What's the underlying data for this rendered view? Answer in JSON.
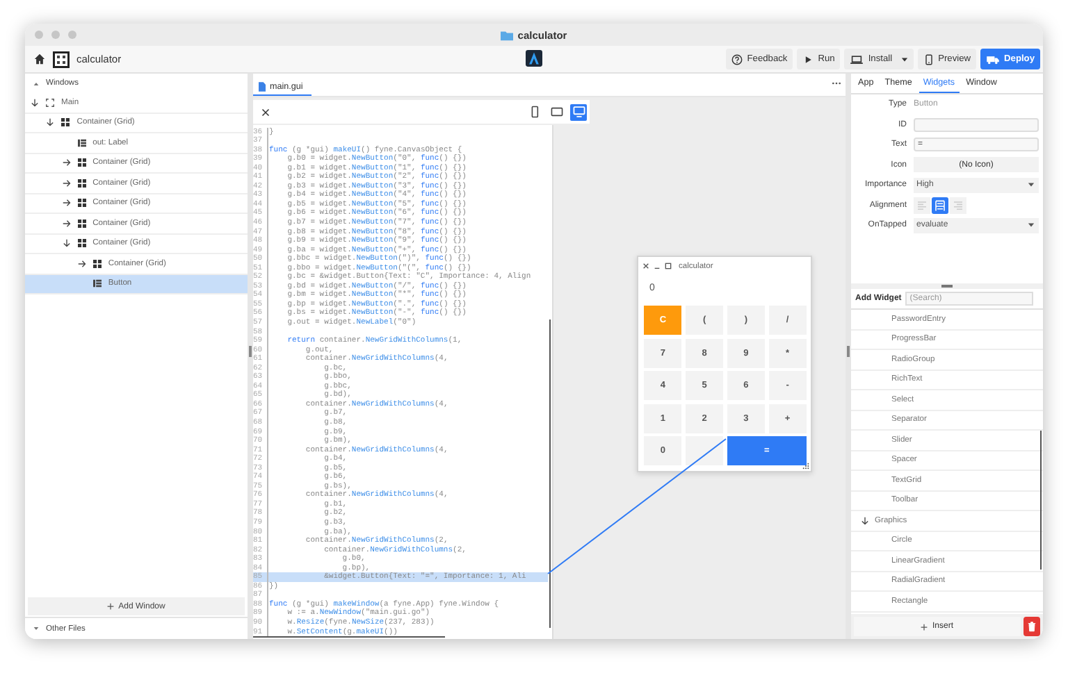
{
  "window": {
    "title": "calculator"
  },
  "toolbar": {
    "project": "calculator",
    "buttons": [
      {
        "label": "Feedback",
        "kind": "help",
        "primary": false,
        "dropdown": false
      },
      {
        "label": "Run",
        "kind": "run",
        "primary": false,
        "dropdown": false
      },
      {
        "label": "Install",
        "kind": "install",
        "primary": false,
        "dropdown": true
      },
      {
        "label": "Preview",
        "kind": "preview",
        "primary": false,
        "dropdown": false
      },
      {
        "label": "Deploy",
        "kind": "deploy",
        "primary": true,
        "dropdown": false
      }
    ]
  },
  "sidebar": {
    "header": "Windows",
    "tree": [
      {
        "label": "Main",
        "kind": "window",
        "expanded": true,
        "selected": false,
        "children": [
          {
            "label": "Container (Grid)",
            "kind": "container",
            "expanded": true,
            "selected": false,
            "children": [
              {
                "label": "out: Label",
                "kind": "widget",
                "selected": false
              },
              {
                "label": "Container (Grid)",
                "kind": "container",
                "expanded": false,
                "selected": false
              },
              {
                "label": "Container (Grid)",
                "kind": "container",
                "expanded": false,
                "selected": false
              },
              {
                "label": "Container (Grid)",
                "kind": "container",
                "expanded": false,
                "selected": false
              },
              {
                "label": "Container (Grid)",
                "kind": "container",
                "expanded": false,
                "selected": false
              },
              {
                "label": "Container (Grid)",
                "kind": "container",
                "expanded": true,
                "selected": false,
                "children": [
                  {
                    "label": "Container (Grid)",
                    "kind": "container",
                    "expanded": false,
                    "selected": false
                  },
                  {
                    "label": "Button",
                    "kind": "widget",
                    "selected": true
                  }
                ]
              }
            ]
          }
        ]
      }
    ],
    "add_button": "Add Window",
    "footer": "Other Files"
  },
  "editor": {
    "tabs": [
      {
        "label": "main.gui",
        "selected": true
      }
    ],
    "devices": [
      {
        "kind": "phone",
        "selected": false
      },
      {
        "kind": "tablet",
        "selected": false
      },
      {
        "kind": "desktop",
        "selected": true
      }
    ],
    "lines": [
      {
        "number": "36",
        "selected": false,
        "tokens": [
          {
            "kind": "plain",
            "text": "}"
          }
        ]
      },
      {
        "number": "37",
        "selected": false
      },
      {
        "number": "38",
        "selected": false,
        "tokens": [
          {
            "kind": "keyword",
            "text": "func"
          },
          {
            "kind": "plain",
            "text": " (g *gui) "
          },
          {
            "kind": "call",
            "text": "makeUI"
          },
          {
            "kind": "plain",
            "text": "() fyne.CanvasObject {"
          }
        ]
      },
      {
        "number": "39",
        "selected": false,
        "tokens": [
          {
            "kind": "plain",
            "text": "    g.b0 = widget."
          },
          {
            "kind": "call",
            "text": "NewButton"
          },
          {
            "kind": "plain",
            "text": "(\"0\", "
          },
          {
            "kind": "keyword",
            "text": "func"
          },
          {
            "kind": "plain",
            "text": "() {})"
          }
        ]
      },
      {
        "number": "40",
        "selected": false,
        "tokens": [
          {
            "kind": "plain",
            "text": "    g.b1 = widget."
          },
          {
            "kind": "call",
            "text": "NewButton"
          },
          {
            "kind": "plain",
            "text": "(\"1\", "
          },
          {
            "kind": "keyword",
            "text": "func"
          },
          {
            "kind": "plain",
            "text": "() {})"
          }
        ]
      },
      {
        "number": "41",
        "selected": false,
        "tokens": [
          {
            "kind": "plain",
            "text": "    g.b2 = widget."
          },
          {
            "kind": "call",
            "text": "NewButton"
          },
          {
            "kind": "plain",
            "text": "(\"2\", "
          },
          {
            "kind": "keyword",
            "text": "func"
          },
          {
            "kind": "plain",
            "text": "() {})"
          }
        ]
      },
      {
        "number": "42",
        "selected": false,
        "tokens": [
          {
            "kind": "plain",
            "text": "    g.b3 = widget."
          },
          {
            "kind": "call",
            "text": "NewButton"
          },
          {
            "kind": "plain",
            "text": "(\"3\", "
          },
          {
            "kind": "keyword",
            "text": "func"
          },
          {
            "kind": "plain",
            "text": "() {})"
          }
        ]
      },
      {
        "number": "43",
        "selected": false,
        "tokens": [
          {
            "kind": "plain",
            "text": "    g.b4 = widget."
          },
          {
            "kind": "call",
            "text": "NewButton"
          },
          {
            "kind": "plain",
            "text": "(\"4\", "
          },
          {
            "kind": "keyword",
            "text": "func"
          },
          {
            "kind": "plain",
            "text": "() {})"
          }
        ]
      },
      {
        "number": "44",
        "selected": false,
        "tokens": [
          {
            "kind": "plain",
            "text": "    g.b5 = widget."
          },
          {
            "kind": "call",
            "text": "NewButton"
          },
          {
            "kind": "plain",
            "text": "(\"5\", "
          },
          {
            "kind": "keyword",
            "text": "func"
          },
          {
            "kind": "plain",
            "text": "() {})"
          }
        ]
      },
      {
        "number": "45",
        "selected": false,
        "tokens": [
          {
            "kind": "plain",
            "text": "    g.b6 = widget."
          },
          {
            "kind": "call",
            "text": "NewButton"
          },
          {
            "kind": "plain",
            "text": "(\"6\", "
          },
          {
            "kind": "keyword",
            "text": "func"
          },
          {
            "kind": "plain",
            "text": "() {})"
          }
        ]
      },
      {
        "number": "46",
        "selected": false,
        "tokens": [
          {
            "kind": "plain",
            "text": "    g.b7 = widget."
          },
          {
            "kind": "call",
            "text": "NewButton"
          },
          {
            "kind": "plain",
            "text": "(\"7\", "
          },
          {
            "kind": "keyword",
            "text": "func"
          },
          {
            "kind": "plain",
            "text": "() {})"
          }
        ]
      },
      {
        "number": "47",
        "selected": false,
        "tokens": [
          {
            "kind": "plain",
            "text": "    g.b8 = widget."
          },
          {
            "kind": "call",
            "text": "NewButton"
          },
          {
            "kind": "plain",
            "text": "(\"8\", "
          },
          {
            "kind": "keyword",
            "text": "func"
          },
          {
            "kind": "plain",
            "text": "() {})"
          }
        ]
      },
      {
        "number": "48",
        "selected": false,
        "tokens": [
          {
            "kind": "plain",
            "text": "    g.b9 = widget."
          },
          {
            "kind": "call",
            "text": "NewButton"
          },
          {
            "kind": "plain",
            "text": "(\"9\", "
          },
          {
            "kind": "keyword",
            "text": "func"
          },
          {
            "kind": "plain",
            "text": "() {})"
          }
        ]
      },
      {
        "number": "49",
        "selected": false,
        "tokens": [
          {
            "kind": "plain",
            "text": "    g.ba = widget."
          },
          {
            "kind": "call",
            "text": "NewButton"
          },
          {
            "kind": "plain",
            "text": "(\"+\", "
          },
          {
            "kind": "keyword",
            "text": "func"
          },
          {
            "kind": "plain",
            "text": "() {})"
          }
        ]
      },
      {
        "number": "50",
        "selected": false,
        "tokens": [
          {
            "kind": "plain",
            "text": "    g.bbc = widget."
          },
          {
            "kind": "call",
            "text": "NewButton"
          },
          {
            "kind": "plain",
            "text": "(\")\", "
          },
          {
            "kind": "keyword",
            "text": "func"
          },
          {
            "kind": "plain",
            "text": "() {})"
          }
        ]
      },
      {
        "number": "51",
        "selected": false,
        "tokens": [
          {
            "kind": "plain",
            "text": "    g.bbo = widget."
          },
          {
            "kind": "call",
            "text": "NewButton"
          },
          {
            "kind": "plain",
            "text": "(\"(\", "
          },
          {
            "kind": "keyword",
            "text": "func"
          },
          {
            "kind": "plain",
            "text": "() {})"
          }
        ]
      },
      {
        "number": "52",
        "selected": false,
        "tokens": [
          {
            "kind": "plain",
            "text": "    g.bc = &widget.Button{Text: \"C\", Importance: 4, Align"
          }
        ]
      },
      {
        "number": "53",
        "selected": false,
        "tokens": [
          {
            "kind": "plain",
            "text": "    g.bd = widget."
          },
          {
            "kind": "call",
            "text": "NewButton"
          },
          {
            "kind": "plain",
            "text": "(\"/\", "
          },
          {
            "kind": "keyword",
            "text": "func"
          },
          {
            "kind": "plain",
            "text": "() {})"
          }
        ]
      },
      {
        "number": "54",
        "selected": false,
        "tokens": [
          {
            "kind": "plain",
            "text": "    g.bm = widget."
          },
          {
            "kind": "call",
            "text": "NewButton"
          },
          {
            "kind": "plain",
            "text": "(\"*\", "
          },
          {
            "kind": "keyword",
            "text": "func"
          },
          {
            "kind": "plain",
            "text": "() {})"
          }
        ]
      },
      {
        "number": "55",
        "selected": false,
        "tokens": [
          {
            "kind": "plain",
            "text": "    g.bp = widget."
          },
          {
            "kind": "call",
            "text": "NewButton"
          },
          {
            "kind": "plain",
            "text": "(\".\", "
          },
          {
            "kind": "keyword",
            "text": "func"
          },
          {
            "kind": "plain",
            "text": "() {})"
          }
        ]
      },
      {
        "number": "56",
        "selected": false,
        "tokens": [
          {
            "kind": "plain",
            "text": "    g.bs = widget."
          },
          {
            "kind": "call",
            "text": "NewButton"
          },
          {
            "kind": "plain",
            "text": "(\"-\", "
          },
          {
            "kind": "keyword",
            "text": "func"
          },
          {
            "kind": "plain",
            "text": "() {})"
          }
        ]
      },
      {
        "number": "57",
        "selected": false,
        "tokens": [
          {
            "kind": "plain",
            "text": "    g.out = widget."
          },
          {
            "kind": "call",
            "text": "NewLabel"
          },
          {
            "kind": "plain",
            "text": "(\"0\")"
          }
        ]
      },
      {
        "number": "58",
        "selected": false
      },
      {
        "number": "59",
        "selected": false,
        "tokens": [
          {
            "kind": "keyword",
            "text": "    return"
          },
          {
            "kind": "plain",
            "text": " container."
          },
          {
            "kind": "call",
            "text": "NewGridWithColumns"
          },
          {
            "kind": "plain",
            "text": "(1,"
          }
        ]
      },
      {
        "number": "60",
        "selected": false,
        "tokens": [
          {
            "kind": "plain",
            "text": "        g.out,"
          }
        ]
      },
      {
        "number": "61",
        "selected": false,
        "tokens": [
          {
            "kind": "plain",
            "text": "        container."
          },
          {
            "kind": "call",
            "text": "NewGridWithColumns"
          },
          {
            "kind": "plain",
            "text": "(4,"
          }
        ]
      },
      {
        "number": "62",
        "selected": false,
        "tokens": [
          {
            "kind": "plain",
            "text": "            g.bc,"
          }
        ]
      },
      {
        "number": "63",
        "selected": false,
        "tokens": [
          {
            "kind": "plain",
            "text": "            g.bbo,"
          }
        ]
      },
      {
        "number": "64",
        "selected": false,
        "tokens": [
          {
            "kind": "plain",
            "text": "            g.bbc,"
          }
        ]
      },
      {
        "number": "65",
        "selected": false,
        "tokens": [
          {
            "kind": "plain",
            "text": "            g.bd),"
          }
        ]
      },
      {
        "number": "66",
        "selected": false,
        "tokens": [
          {
            "kind": "plain",
            "text": "        container."
          },
          {
            "kind": "call",
            "text": "NewGridWithColumns"
          },
          {
            "kind": "plain",
            "text": "(4,"
          }
        ]
      },
      {
        "number": "67",
        "selected": false,
        "tokens": [
          {
            "kind": "plain",
            "text": "            g.b7,"
          }
        ]
      },
      {
        "number": "68",
        "selected": false,
        "tokens": [
          {
            "kind": "plain",
            "text": "            g.b8,"
          }
        ]
      },
      {
        "number": "69",
        "selected": false,
        "tokens": [
          {
            "kind": "plain",
            "text": "            g.b9,"
          }
        ]
      },
      {
        "number": "70",
        "selected": false,
        "tokens": [
          {
            "kind": "plain",
            "text": "            g.bm),"
          }
        ]
      },
      {
        "number": "71",
        "selected": false,
        "tokens": [
          {
            "kind": "plain",
            "text": "        container."
          },
          {
            "kind": "call",
            "text": "NewGridWithColumns"
          },
          {
            "kind": "plain",
            "text": "(4,"
          }
        ]
      },
      {
        "number": "72",
        "selected": false,
        "tokens": [
          {
            "kind": "plain",
            "text": "            g.b4,"
          }
        ]
      },
      {
        "number": "73",
        "selected": false,
        "tokens": [
          {
            "kind": "plain",
            "text": "            g.b5,"
          }
        ]
      },
      {
        "number": "74",
        "selected": false,
        "tokens": [
          {
            "kind": "plain",
            "text": "            g.b6,"
          }
        ]
      },
      {
        "number": "75",
        "selected": false,
        "tokens": [
          {
            "kind": "plain",
            "text": "            g.bs),"
          }
        ]
      },
      {
        "number": "76",
        "selected": false,
        "tokens": [
          {
            "kind": "plain",
            "text": "        container."
          },
          {
            "kind": "call",
            "text": "NewGridWithColumns"
          },
          {
            "kind": "plain",
            "text": "(4,"
          }
        ]
      },
      {
        "number": "77",
        "selected": false,
        "tokens": [
          {
            "kind": "plain",
            "text": "            g.b1,"
          }
        ]
      },
      {
        "number": "78",
        "selected": false,
        "tokens": [
          {
            "kind": "plain",
            "text": "            g.b2,"
          }
        ]
      },
      {
        "number": "79",
        "selected": false,
        "tokens": [
          {
            "kind": "plain",
            "text": "            g.b3,"
          }
        ]
      },
      {
        "number": "80",
        "selected": false,
        "tokens": [
          {
            "kind": "plain",
            "text": "            g.ba),"
          }
        ]
      },
      {
        "number": "81",
        "selected": false,
        "tokens": [
          {
            "kind": "plain",
            "text": "        container."
          },
          {
            "kind": "call",
            "text": "NewGridWithColumns"
          },
          {
            "kind": "plain",
            "text": "(2,"
          }
        ]
      },
      {
        "number": "82",
        "selected": false,
        "tokens": [
          {
            "kind": "plain",
            "text": "            container."
          },
          {
            "kind": "call",
            "text": "NewGridWithColumns"
          },
          {
            "kind": "plain",
            "text": "(2,"
          }
        ]
      },
      {
        "number": "83",
        "selected": false,
        "tokens": [
          {
            "kind": "plain",
            "text": "                g.b0,"
          }
        ]
      },
      {
        "number": "84",
        "selected": false,
        "tokens": [
          {
            "kind": "plain",
            "text": "                g.bp),"
          }
        ]
      },
      {
        "number": "85",
        "selected": true,
        "tokens": [
          {
            "kind": "plain",
            "text": "            &widget.Button{Text: \"=\", Importance: 1, Ali"
          }
        ]
      },
      {
        "number": "86",
        "selected": false,
        "tokens": [
          {
            "kind": "plain",
            "text": "})"
          }
        ]
      },
      {
        "number": "87",
        "selected": false
      },
      {
        "number": "88",
        "selected": false,
        "tokens": [
          {
            "kind": "keyword",
            "text": "func"
          },
          {
            "kind": "plain",
            "text": " (g *gui) "
          },
          {
            "kind": "call",
            "text": "makeWindow"
          },
          {
            "kind": "plain",
            "text": "(a fyne.App) fyne.Window {"
          }
        ]
      },
      {
        "number": "89",
        "selected": false,
        "tokens": [
          {
            "kind": "plain",
            "text": "    w := a."
          },
          {
            "kind": "call",
            "text": "NewWindow"
          },
          {
            "kind": "plain",
            "text": "(\"main.gui.go\")"
          }
        ]
      },
      {
        "number": "90",
        "selected": false,
        "tokens": [
          {
            "kind": "plain",
            "text": "    w."
          },
          {
            "kind": "call",
            "text": "Resize"
          },
          {
            "kind": "plain",
            "text": "(fyne."
          },
          {
            "kind": "call",
            "text": "NewSize"
          },
          {
            "kind": "plain",
            "text": "(237, 283))"
          }
        ]
      },
      {
        "number": "91",
        "selected": false,
        "tokens": [
          {
            "kind": "plain",
            "text": "    w."
          },
          {
            "kind": "call",
            "text": "SetContent"
          },
          {
            "kind": "plain",
            "text": "(g."
          },
          {
            "kind": "call",
            "text": "makeUI"
          },
          {
            "kind": "plain",
            "text": "())"
          }
        ]
      }
    ]
  },
  "preview": {
    "title": "calculator",
    "display": "0",
    "keys": [
      {
        "label": "C",
        "kind": "warning"
      },
      {
        "label": "(",
        "kind": "normal"
      },
      {
        "label": ")",
        "kind": "normal"
      },
      {
        "label": "/",
        "kind": "normal"
      },
      {
        "label": "7",
        "kind": "normal"
      },
      {
        "label": "8",
        "kind": "normal"
      },
      {
        "label": "9",
        "kind": "normal"
      },
      {
        "label": "*",
        "kind": "normal"
      },
      {
        "label": "4",
        "kind": "normal"
      },
      {
        "label": "5",
        "kind": "normal"
      },
      {
        "label": "6",
        "kind": "normal"
      },
      {
        "label": "-",
        "kind": "normal"
      },
      {
        "label": "1",
        "kind": "normal"
      },
      {
        "label": "2",
        "kind": "normal"
      },
      {
        "label": "3",
        "kind": "normal"
      },
      {
        "label": "+",
        "kind": "normal"
      },
      {
        "label": "0",
        "kind": "normal"
      },
      {
        "kind": "normal"
      },
      {
        "label": "=",
        "kind": "primary"
      }
    ]
  },
  "inspector": {
    "tabs": [
      {
        "label": "App",
        "selected": false
      },
      {
        "label": "Theme",
        "selected": false
      },
      {
        "label": "Widgets",
        "selected": true
      },
      {
        "label": "Window",
        "selected": false
      }
    ],
    "properties": [
      {
        "label": "Type",
        "kind": "text",
        "value": "Button"
      },
      {
        "label": "ID",
        "kind": "input"
      },
      {
        "label": "Text",
        "kind": "input",
        "value": "="
      },
      {
        "label": "Icon",
        "kind": "button",
        "value": "(No Icon)"
      },
      {
        "label": "Importance",
        "kind": "select",
        "value": "High"
      },
      {
        "label": "Alignment",
        "kind": "align",
        "options": [
          {
            "kind": "left",
            "selected": false
          },
          {
            "kind": "center",
            "selected": true
          },
          {
            "kind": "right",
            "selected": false
          }
        ]
      },
      {
        "label": "OnTapped",
        "kind": "select",
        "value": "evaluate"
      }
    ]
  },
  "widgets": {
    "title": "Add Widget",
    "placeholder": "(Search)",
    "items": [
      {
        "label": "PasswordEntry"
      },
      {
        "label": "ProgressBar"
      },
      {
        "label": "RadioGroup"
      },
      {
        "label": "RichText"
      },
      {
        "label": "Select"
      },
      {
        "label": "Separator"
      },
      {
        "label": "Slider"
      },
      {
        "label": "Spacer"
      },
      {
        "label": "TextGrid"
      },
      {
        "label": "Toolbar"
      },
      {
        "label": "Graphics",
        "expanded": true,
        "children": [
          {
            "label": "Circle"
          },
          {
            "label": "LinearGradient"
          },
          {
            "label": "RadialGradient"
          },
          {
            "label": "Rectangle"
          }
        ]
      }
    ],
    "insert": "Insert"
  }
}
